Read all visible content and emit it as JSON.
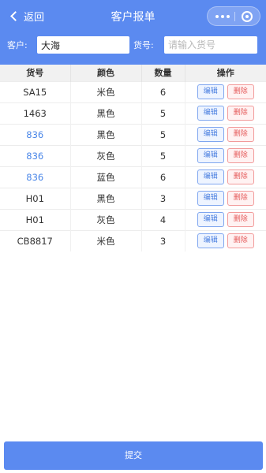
{
  "nav": {
    "back_label": "返回",
    "title": "客户报单"
  },
  "filter": {
    "customer_label": "客户:",
    "customer_value": "大海",
    "code_label": "货号:",
    "code_placeholder": "请输入货号"
  },
  "table": {
    "headers": [
      "货号",
      "颜色",
      "数量",
      "操作"
    ],
    "edit_label": "编辑",
    "delete_label": "删除",
    "rows": [
      {
        "code": "SA15",
        "color": "米色",
        "qty": "6"
      },
      {
        "code": "1463",
        "color": "黑色",
        "qty": "5"
      },
      {
        "code": "836",
        "color": "黑色",
        "qty": "5"
      },
      {
        "code": "836",
        "color": "灰色",
        "qty": "5"
      },
      {
        "code": "836",
        "color": "蓝色",
        "qty": "6"
      },
      {
        "code": "H01",
        "color": "黑色",
        "qty": "3"
      },
      {
        "code": "H01",
        "color": "灰色",
        "qty": "4"
      },
      {
        "code": "CB8817",
        "color": "米色",
        "qty": "3"
      }
    ]
  },
  "submit_label": "提交",
  "colors": {
    "primary": "#5b8af0",
    "link": "#4a86e8",
    "danger": "#e55b5b"
  }
}
